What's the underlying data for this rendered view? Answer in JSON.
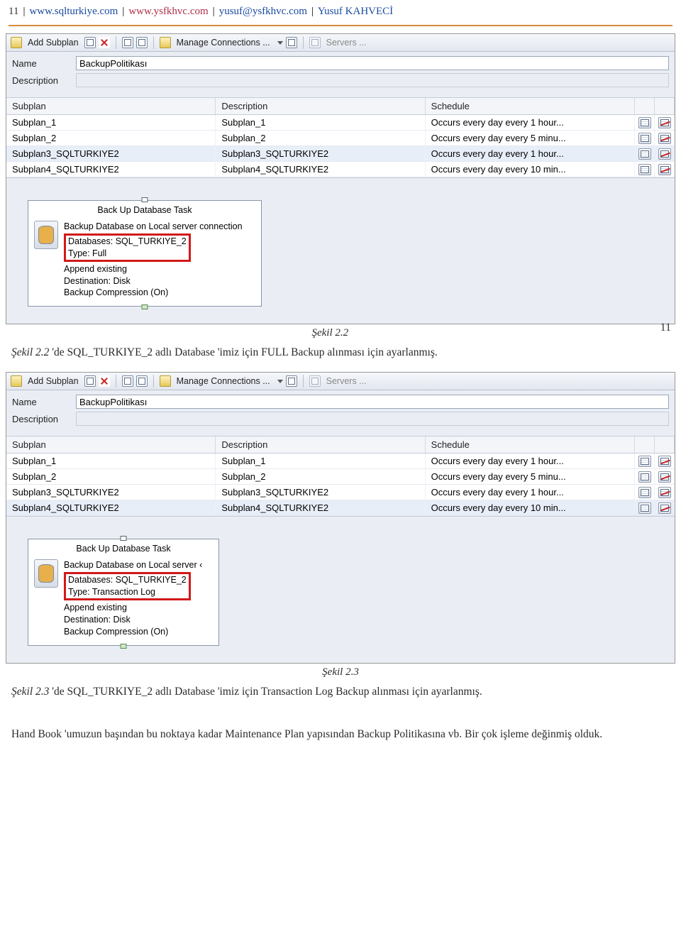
{
  "header": {
    "pageno": "11",
    "link1": "www.sqlturkiye.com",
    "link2": "www.ysfkhvc.com",
    "email": "yusuf@ysfkhvc.com",
    "name": "Yusuf KAHVECİ",
    "sep": "|"
  },
  "shot1": {
    "toolbar": {
      "add_subplan": "Add Subplan",
      "manage_conn": "Manage Connections ...",
      "servers": "Servers ..."
    },
    "form": {
      "name_label": "Name",
      "name_value": "BackupPolitikası",
      "desc_label": "Description",
      "desc_value": ""
    },
    "grid": {
      "h1": "Subplan",
      "h2": "Description",
      "h3": "Schedule",
      "rows": [
        {
          "c1": "Subplan_1",
          "c2": "Subplan_1",
          "c3": "Occurs every day every 1 hour...",
          "sel": false
        },
        {
          "c1": "Subplan_2",
          "c2": "Subplan_2",
          "c3": "Occurs every day every 5 minu...",
          "sel": false
        },
        {
          "c1": "Subplan3_SQLTURKIYE2",
          "c2": "Subplan3_SQLTURKIYE2",
          "c3": "Occurs every day every 1 hour...",
          "sel": true
        },
        {
          "c1": "Subplan4_SQLTURKIYE2",
          "c2": "Subplan4_SQLTURKIYE2",
          "c3": "Occurs every day every 10 min...",
          "sel": false
        }
      ]
    },
    "task": {
      "title": "Back Up Database Task",
      "l1": "Backup Database on Local server connection",
      "r1": "Databases: SQL_TURKIYE_2",
      "r2": "Type: Full",
      "l2": "Append existing",
      "l3": "Destination: Disk",
      "l4": "Backup Compression (On)"
    },
    "caption": "Şekil 2.2",
    "sidenum": "11"
  },
  "para1": {
    "lead": "Şekil 2.2",
    "rest": " 'de SQL_TURKIYE_2 adlı Database 'imiz için  FULL Backup alınması için ayarlanmış."
  },
  "shot2": {
    "toolbar": {
      "add_subplan": "Add Subplan",
      "manage_conn": "Manage Connections ...",
      "servers": "Servers ..."
    },
    "form": {
      "name_label": "Name",
      "name_value": "BackupPolitikası",
      "desc_label": "Description",
      "desc_value": ""
    },
    "grid": {
      "h1": "Subplan",
      "h2": "Description",
      "h3": "Schedule",
      "rows": [
        {
          "c1": "Subplan_1",
          "c2": "Subplan_1",
          "c3": "Occurs every day every 1 hour...",
          "sel": false
        },
        {
          "c1": "Subplan_2",
          "c2": "Subplan_2",
          "c3": "Occurs every day every 5 minu...",
          "sel": false
        },
        {
          "c1": "Subplan3_SQLTURKIYE2",
          "c2": "Subplan3_SQLTURKIYE2",
          "c3": "Occurs every day every 1 hour...",
          "sel": false
        },
        {
          "c1": "Subplan4_SQLTURKIYE2",
          "c2": "Subplan4_SQLTURKIYE2",
          "c3": "Occurs every day every 10 min...",
          "sel": true
        }
      ]
    },
    "task": {
      "title": "Back Up Database Task",
      "l1": "Backup Database on Local server ‹",
      "r1": "Databases: SQL_TURKIYE_2",
      "r2": "Type: Transaction Log",
      "l2": "Append existing",
      "l3": "Destination: Disk",
      "l4": "Backup Compression (On)"
    },
    "caption": "Şekil 2.3"
  },
  "para2": {
    "lead": "Şekil 2.3",
    "rest": " 'de SQL_TURKIYE_2 adlı Database 'imiz için  Transaction Log Backup alınması için ayarlanmış."
  },
  "para3": "Hand Book 'umuzun başından bu noktaya kadar Maintenance Plan yapısından Backup Politikasına vb. Bir çok işleme değinmiş olduk."
}
